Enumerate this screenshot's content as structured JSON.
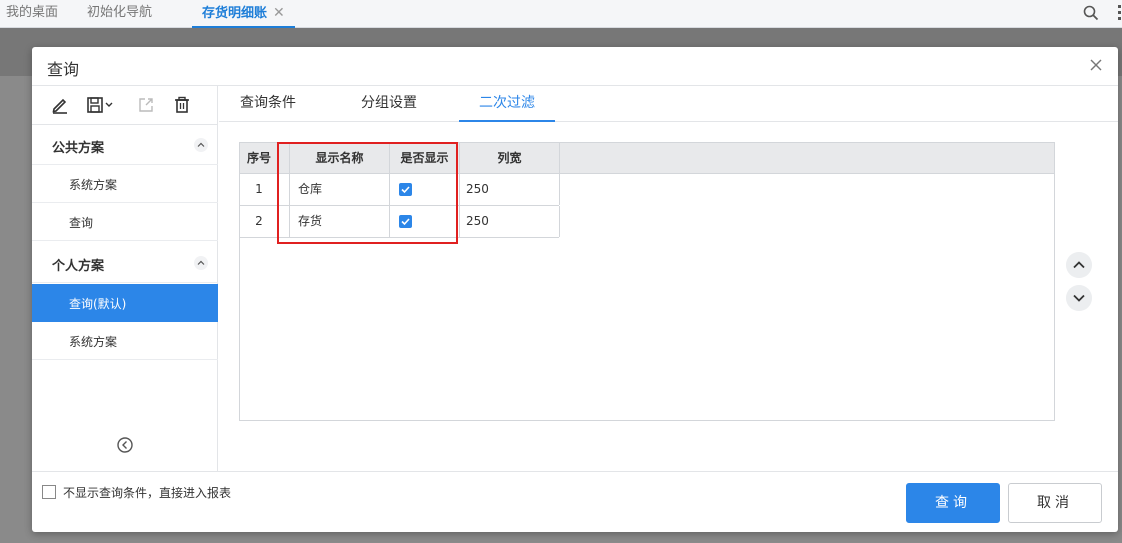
{
  "top_tabs": [
    {
      "label": "我的桌面"
    },
    {
      "label": "初始化导航"
    },
    {
      "label": "存货明细账",
      "close": "✕"
    }
  ],
  "dialog": {
    "title": "查询",
    "close_icon": "close-icon"
  },
  "sidebar": {
    "tools": [
      "edit-icon",
      "save-dropdown-icon",
      "export-icon",
      "delete-icon"
    ],
    "groups": [
      {
        "label": "公共方案",
        "items": [
          "系统方案",
          "查询"
        ]
      },
      {
        "label": "个人方案",
        "items": [
          "查询(默认)",
          "系统方案"
        ]
      }
    ],
    "selected_item": "查询(默认)"
  },
  "tabs": [
    "查询条件",
    "分组设置",
    "二次过滤"
  ],
  "active_tab": "二次过滤",
  "grid": {
    "headers": [
      "序号",
      "显示名称",
      "是否显示",
      "列宽"
    ],
    "rows": [
      {
        "index": "1",
        "name": "仓库",
        "visible": true,
        "width": "250"
      },
      {
        "index": "2",
        "name": "存货",
        "visible": true,
        "width": "250"
      }
    ]
  },
  "footer": {
    "skip_label": "不显示查询条件，直接进入报表",
    "skip_checked": false,
    "query_button": "查询",
    "cancel_button": "取消"
  },
  "colors": {
    "accent": "#2c86e8",
    "highlight_box": "#e02020"
  }
}
